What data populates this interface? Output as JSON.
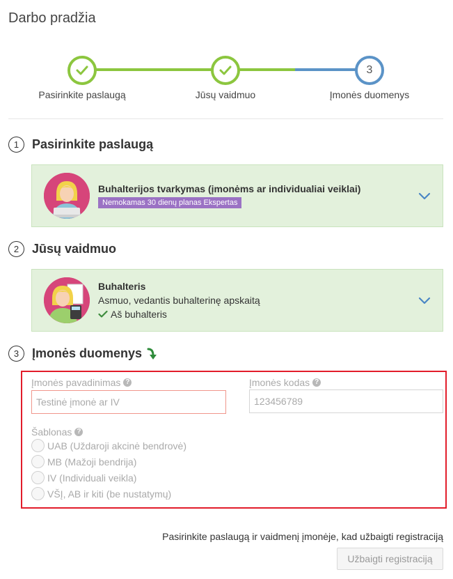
{
  "page": {
    "title": "Darbo pradžia"
  },
  "stepper": {
    "steps": [
      {
        "label": "Pasirinkite paslaugą",
        "state": "done"
      },
      {
        "label": "Jūsų vaidmuo",
        "state": "done"
      },
      {
        "label": "Įmonės duomenys",
        "state": "current",
        "number": "3"
      }
    ],
    "colors": {
      "done": "#8cc63f",
      "current": "#5b93c7"
    }
  },
  "section1": {
    "number": "1",
    "title": "Pasirinkite paslaugą",
    "card": {
      "title": "Buhalterijos tvarkymas (įmonėms ar individualiai veiklai)",
      "badge": "Nemokamas 30 dienų planas Ekspertas",
      "icon": "accountant-laptop-avatar"
    }
  },
  "section2": {
    "number": "2",
    "title": "Jūsų vaidmuo",
    "card": {
      "title": "Buhalteris",
      "description": "Asmuo, vedantis buhalterinę apskaitą",
      "check_label": "Aš buhalteris",
      "icon": "accountant-calculator-avatar"
    }
  },
  "section3": {
    "number": "3",
    "title": "Įmonės duomenys",
    "form": {
      "company_name": {
        "label": "Įmonės pavadinimas",
        "placeholder": "Testinė įmonė ar IV",
        "value": ""
      },
      "company_code": {
        "label": "Įmonės kodas",
        "placeholder": "123456789",
        "value": ""
      },
      "template": {
        "label": "Šablonas",
        "options": [
          "UAB (Uždaroji akcinė bendrovė)",
          "MB (Mažoji bendrija)",
          "IV (Individuali veikla)",
          "VŠĮ, AB ir kiti (be nustatymų)"
        ]
      }
    }
  },
  "footer": {
    "hint": "Pasirinkite paslaugą ir vaidmenį įmonėje, kad užbaigti registraciją",
    "submit_label": "Užbaigti registraciją"
  },
  "colors": {
    "card_bg": "#e3f1dc",
    "badge_bg": "#9b72c4",
    "highlight_border": "#e21c2a",
    "chevron": "#4a86c5"
  }
}
